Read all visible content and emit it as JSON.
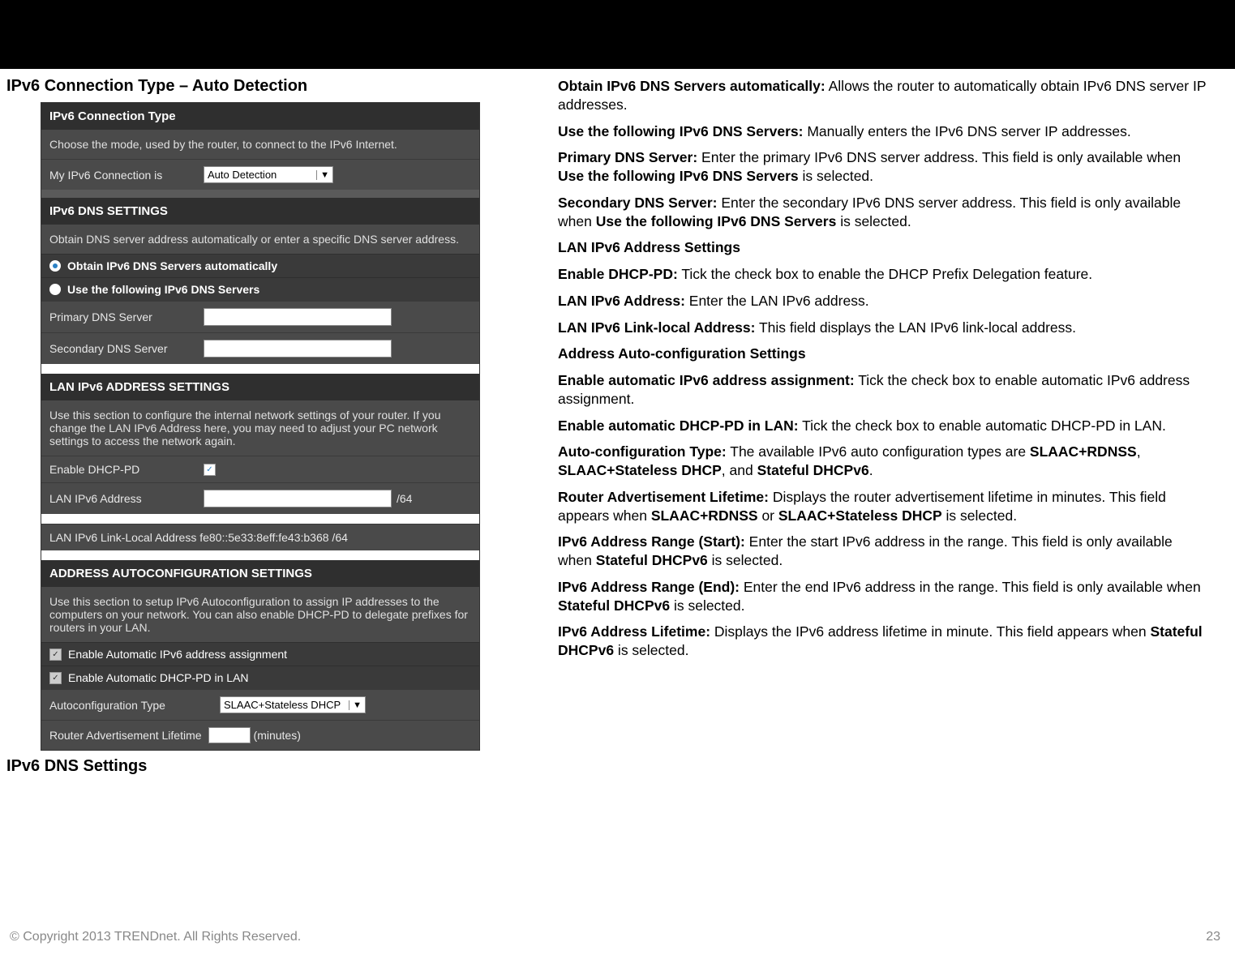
{
  "page_title": "IPv6 Connection Type – Auto Detection",
  "panel": {
    "sec1_head": "IPv6 Connection Type",
    "sec1_desc": "Choose the mode, used by the router, to connect to the IPv6 Internet.",
    "conn_label": "My IPv6 Connection is",
    "conn_value": "Auto Detection",
    "sec2_head": "IPv6 DNS SETTINGS",
    "sec2_desc": "Obtain DNS server address automatically or enter a specific DNS server address.",
    "radio1": "Obtain IPv6 DNS Servers automatically",
    "radio2": "Use the following IPv6 DNS Servers",
    "pdns_label": "Primary DNS Server",
    "sdns_label": "Secondary DNS Server",
    "sec3_head": "LAN IPv6 ADDRESS SETTINGS",
    "sec3_desc": "Use this section to configure the internal network settings of your router. If you change the LAN IPv6 Address here, you may need to adjust your PC network settings to access the network again.",
    "dhcp_pd_label": "Enable DHCP-PD",
    "lan_addr_label": "LAN IPv6 Address",
    "lan_addr_suffix": "/64",
    "linklocal": "LAN IPv6 Link-Local Address fe80::5e33:8eff:fe43:b368 /64",
    "sec4_head": "ADDRESS AUTOCONFIGURATION SETTINGS",
    "sec4_desc": "Use this section to setup IPv6 Autoconfiguration to assign IP addresses to the computers on your network. You can also enable DHCP-PD to delegate prefixes for routers in your LAN.",
    "auto_assign": "Enable Automatic IPv6 address assignment",
    "auto_pd": "Enable Automatic DHCP-PD in LAN",
    "autoconf_label": "Autoconfiguration Type",
    "autoconf_value": "SLAAC+Stateless DHCP",
    "ra_lifetime_label": "Router Advertisement Lifetime",
    "ra_lifetime_unit": "(minutes)"
  },
  "sub_heading": "IPv6 DNS Settings",
  "doc": {
    "p1a": "Obtain IPv6 DNS Servers automatically:",
    "p1b": " Allows the router to automatically obtain IPv6 DNS server IP addresses.",
    "p2a": "Use the following IPv6 DNS Servers:",
    "p2b": " Manually enters the IPv6 DNS server IP addresses.",
    "p3a": "Primary DNS Server:",
    "p3b": " Enter the primary IPv6 DNS server address. This field is only available when ",
    "p3c": "Use the following IPv6 DNS Servers",
    "p3d": " is selected.",
    "p4a": "Secondary DNS Server:",
    "p4b": " Enter the secondary IPv6 DNS server address. This field is only available when ",
    "p4c": "Use the following IPv6 DNS Servers",
    "p4d": " is selected.",
    "h5": "LAN IPv6 Address Settings",
    "p6a": "Enable DHCP-PD:",
    "p6b": " Tick the check box to enable the DHCP Prefix Delegation feature.",
    "p7a": "LAN IPv6 Address:",
    "p7b": " Enter the LAN IPv6 address.",
    "p8a": "LAN IPv6 Link-local Address:",
    "p8b": " This field displays the LAN IPv6 link-local address.",
    "h9": "Address Auto-configuration Settings",
    "p10a": "Enable automatic IPv6 address assignment:",
    "p10b": " Tick the check box to enable automatic IPv6 address assignment.",
    "p11a": "Enable automatic DHCP-PD in LAN:",
    "p11b": " Tick the check box to enable automatic DHCP-PD in LAN.",
    "p12a": "Auto-configuration Type:",
    "p12b": " The available IPv6 auto configuration types are ",
    "p12c": "SLAAC+RDNSS",
    "p12d": ", ",
    "p12e": "SLAAC+Stateless DHCP",
    "p12f": ", and ",
    "p12g": "Stateful DHCPv6",
    "p12h": ".",
    "p13a": "Router Advertisement Lifetime:",
    "p13b": " Displays the router advertisement lifetime in minutes. This field appears when ",
    "p13c": "SLAAC+RDNSS",
    "p13d": " or ",
    "p13e": "SLAAC+Stateless DHCP",
    "p13f": " is selected.",
    "p14a": "IPv6 Address Range (Start):",
    "p14b": " Enter the start IPv6 address in the range. This field is only available when ",
    "p14c": "Stateful DHCPv6",
    "p14d": " is selected.",
    "p15a": "IPv6 Address Range (End):",
    "p15b": " Enter the end IPv6 address in the range. This field is only available when ",
    "p15c": "Stateful DHCPv6",
    "p15d": " is selected.",
    "p16a": "IPv6 Address Lifetime:",
    "p16b": " Displays the IPv6 address lifetime in minute. This field appears when ",
    "p16c": "Stateful DHCPv6",
    "p16d": " is selected."
  },
  "footer": {
    "copyright": "© Copyright 2013 TRENDnet. All Rights Reserved.",
    "page_no": "23"
  }
}
